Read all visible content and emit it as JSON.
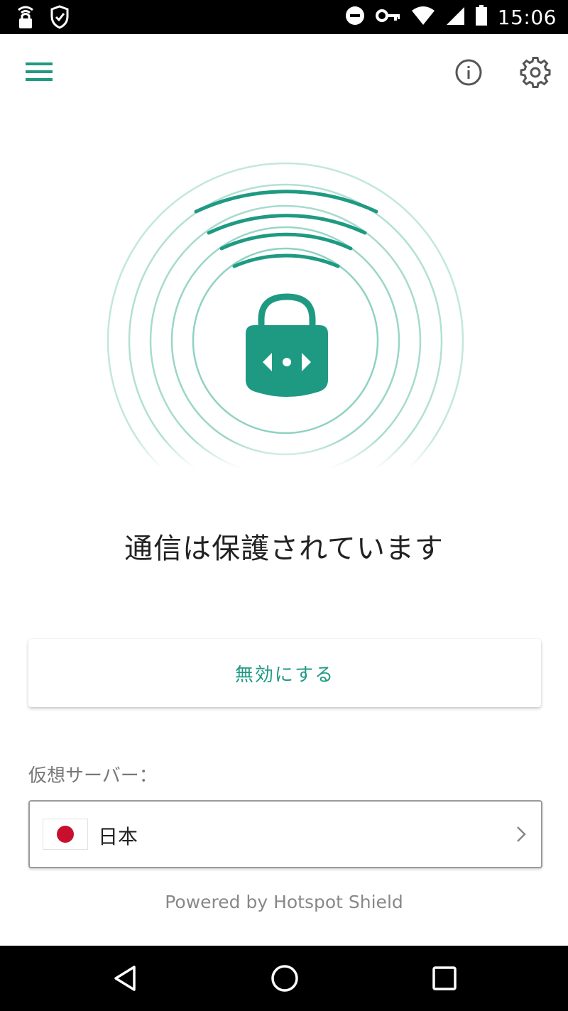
{
  "status_bar": {
    "time": "15:06",
    "icons": [
      "wifi-lock-icon",
      "shield-check-icon",
      "do-not-disturb-icon",
      "vpn-key-icon",
      "wifi-icon",
      "cellular-signal-icon",
      "battery-icon"
    ]
  },
  "app_bar": {
    "icons": [
      "hamburger-menu-icon",
      "info-icon",
      "gear-icon"
    ]
  },
  "main": {
    "status_text": "通信は保護されています",
    "disable_label": "無効にする"
  },
  "server": {
    "label": "仮想サーバー：",
    "name": "日本",
    "flag_icon": "japan-flag-icon"
  },
  "footer": {
    "powered_by": "Powered by Hotspot Shield"
  },
  "nav_bar": {
    "icons": [
      "back-icon",
      "home-icon",
      "recents-icon"
    ]
  },
  "colors": {
    "accent": "#1f9a82",
    "flag_red": "#c8102e"
  }
}
